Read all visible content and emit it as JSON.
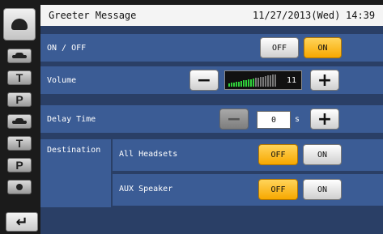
{
  "header": {
    "title": "Greeter Message",
    "date": "11/27/2013(Wed)",
    "time": "14:39"
  },
  "rail": {
    "items": [
      {
        "icon": "car-icon"
      },
      {
        "label": "T"
      },
      {
        "label": "P"
      },
      {
        "icon": "car-icon"
      },
      {
        "label": "T"
      },
      {
        "label": "P"
      },
      {
        "icon": "dot-icon"
      }
    ]
  },
  "onoff": {
    "label": "ON / OFF",
    "off_label": "OFF",
    "on_label": "ON",
    "selected": "ON"
  },
  "volume": {
    "label": "Volume",
    "minus": "−",
    "plus": "+",
    "value": "11",
    "level": 11,
    "max": 20
  },
  "delay": {
    "label": "Delay Time",
    "minus": "−",
    "plus": "+",
    "value": "0",
    "unit": "s"
  },
  "destination": {
    "label": "Destination",
    "items": [
      {
        "label": "All Headsets",
        "off_label": "OFF",
        "on_label": "ON",
        "selected": "OFF"
      },
      {
        "label": "AUX Speaker",
        "off_label": "OFF",
        "on_label": "ON",
        "selected": "OFF"
      }
    ]
  },
  "back_label": "↵",
  "colors": {
    "panel": "#3b5c95",
    "background": "#2a3f66",
    "active": "#f7a800",
    "meter": "#2fd13a"
  }
}
